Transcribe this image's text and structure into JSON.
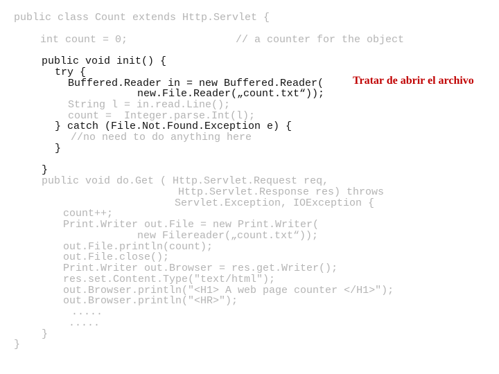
{
  "note": "Tratar de abrir el archivo",
  "note_color": "#c00000",
  "lines": [
    {
      "text": "public class Count extends Http.Servlet {",
      "active": false
    },
    {
      "text": "int count = 0;",
      "active": false
    },
    {
      "text": "// a counter for the object",
      "active": false
    },
    {
      "text": "public void init() {",
      "active": true
    },
    {
      "text": "try {",
      "active": true
    },
    {
      "text": "Buffered.Reader in = new Buffered.Reader(",
      "active": true
    },
    {
      "text": "new.File.Reader(„count.txt“));",
      "active": true
    },
    {
      "text": "String l = in.read.Line();",
      "active": false
    },
    {
      "text": "count =  Integer.parse.Int(l);",
      "active": false
    },
    {
      "text": "} catch (File.Not.Found.Exception e) {",
      "active": true
    },
    {
      "text": "//no need to do anything here",
      "active": false
    },
    {
      "text": "}",
      "active": true
    },
    {
      "text": "}",
      "active": true
    },
    {
      "text": "public void do.Get ( Http.Servlet.Request req,",
      "active": false
    },
    {
      "text": "Http.Servlet.Response res) throws",
      "active": false
    },
    {
      "text": "Servlet.Exception, IOException {",
      "active": false
    },
    {
      "text": "count++;",
      "active": false
    },
    {
      "text": "Print.Writer out.File = new Print.Writer(",
      "active": false
    },
    {
      "text": "new Filereader(„count.txt“));",
      "active": false
    },
    {
      "text": "out.File.println(count);",
      "active": false
    },
    {
      "text": "out.File.close();",
      "active": false
    },
    {
      "text": "Print.Writer out.Browser = res.get.Writer();",
      "active": false
    },
    {
      "text": "res.set.Content.Type(\"text/html\");",
      "active": false
    },
    {
      "text": "out.Browser.println(\"<H1> A web page counter </H1>\");",
      "active": false
    },
    {
      "text": "out.Browser.println(\"<HR>\");",
      "active": false
    },
    {
      "text": ".....",
      "active": false
    },
    {
      "text": ".....",
      "active": false
    },
    {
      "text": "}",
      "active": false
    },
    {
      "text": "}",
      "active": false
    }
  ]
}
